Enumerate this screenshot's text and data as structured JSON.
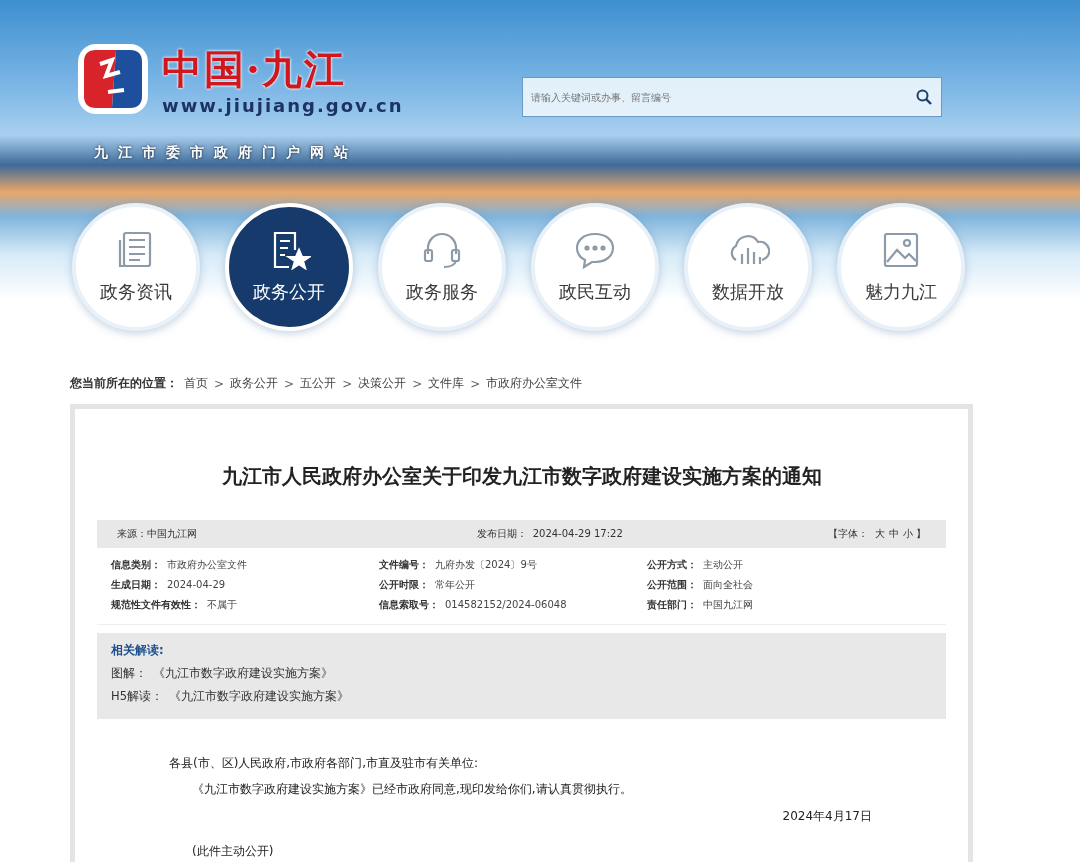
{
  "site": {
    "title": "中国·九江",
    "url": "www.jiujiang.gov.cn",
    "subtitle": "九江市委市政府门户网站"
  },
  "search": {
    "placeholder": "请输入关键词或办事、留言编号"
  },
  "nav": [
    {
      "label": "政务资讯",
      "selected": false
    },
    {
      "label": "政务公开",
      "selected": true
    },
    {
      "label": "政务服务",
      "selected": false
    },
    {
      "label": "政民互动",
      "selected": false
    },
    {
      "label": "数据开放",
      "selected": false
    },
    {
      "label": "魅力九江",
      "selected": false
    }
  ],
  "breadcrumb": {
    "label": "您当前所在的位置：",
    "separator": ">",
    "items": [
      "首页",
      "政务公开",
      "五公开",
      "决策公开",
      "文件库",
      "市政府办公室文件"
    ]
  },
  "article": {
    "title": "九江市人民政府办公室关于印发九江市数字政府建设实施方案的通知",
    "source_label": "来源：",
    "source": "中国九江网",
    "date_label": "发布日期：",
    "date": "2024-04-29 17:22",
    "font_open": "【字体：",
    "font_sizes": [
      "大",
      "中",
      "小"
    ],
    "font_close": "】",
    "info": [
      {
        "label": "信息类别：",
        "value": "市政府办公室文件"
      },
      {
        "label": "文件编号：",
        "value": "九府办发〔2024〕9号"
      },
      {
        "label": "公开方式：",
        "value": "主动公开"
      },
      {
        "label": "生成日期：",
        "value": "2024-04-29"
      },
      {
        "label": "公开时限：",
        "value": "常年公开"
      },
      {
        "label": "公开范围：",
        "value": "面向全社会"
      },
      {
        "label": "规范性文件有效性：",
        "value": "不属于"
      },
      {
        "label": "信息索取号：",
        "value": "014582152/2024-06048"
      },
      {
        "label": "责任部门：",
        "value": "中国九江网"
      }
    ],
    "related": {
      "heading": "相关解读:",
      "items": [
        {
          "label": "图解：",
          "link": "《九江市数字政府建设实施方案》"
        },
        {
          "label": "H5解读：",
          "link": "《九江市数字政府建设实施方案》"
        }
      ]
    },
    "body": {
      "salutation": "各县(市、区)人民政府,市政府各部门,市直及驻市有关单位:",
      "paragraph": "《九江市数字政府建设实施方案》已经市政府同意,现印发给你们,请认真贯彻执行。",
      "date": "2024年4月17日",
      "note": "(此件主动公开)"
    }
  }
}
